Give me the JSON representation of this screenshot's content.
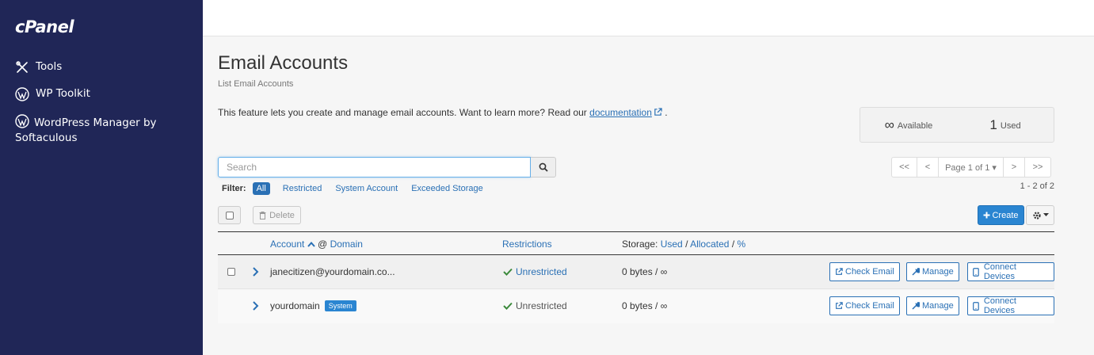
{
  "sidebar": {
    "logo": "cPanel",
    "items": [
      {
        "label": "Tools",
        "icon": "tools-icon"
      },
      {
        "label": "WP Toolkit",
        "icon": "wordpress-icon"
      },
      {
        "label": "WordPress Manager by Softaculous",
        "icon": "wordpress-icon"
      }
    ]
  },
  "page": {
    "title": "Email Accounts",
    "subtitle": "List Email Accounts",
    "intro_text": "This feature lets you create and manage email accounts. Want to learn more? Read our",
    "doc_link": "documentation",
    "intro_end": "."
  },
  "stats": {
    "available_value": "∞",
    "available_label": "Available",
    "used_value": "1",
    "used_label": "Used"
  },
  "search": {
    "placeholder": "Search",
    "value": ""
  },
  "filter": {
    "label": "Filter:",
    "options": [
      "All",
      "Restricted",
      "System Account",
      "Exceeded Storage"
    ],
    "active": "All"
  },
  "pager": {
    "first": "<<",
    "prev": "<",
    "page_label": "Page 1 of 1 ▾",
    "next": ">",
    "last": ">>",
    "range": "1 - 2 of 2"
  },
  "toolbar": {
    "delete_label": "Delete",
    "create_label": "Create"
  },
  "table": {
    "columns": {
      "account": "Account",
      "domain_sep": "@",
      "domain": "Domain",
      "restrictions": "Restrictions",
      "storage_prefix": "Storage:",
      "used": "Used",
      "allocated": "Allocated",
      "percent": "%",
      "sep": "/"
    },
    "rows": [
      {
        "account": "janecitizen@yourdomain.co...",
        "restriction": "Unrestricted",
        "storage": "0 bytes / ∞",
        "badge": ""
      },
      {
        "account": "yourdomain",
        "restriction": "Unrestricted",
        "storage": "0 bytes / ∞",
        "badge": "System"
      }
    ],
    "actions": {
      "check_email": "Check Email",
      "manage": "Manage",
      "connect_devices": "Connect Devices"
    }
  },
  "colors": {
    "sidebar_bg": "#202657",
    "accent": "#2a70b5",
    "create_bg": "#2a85d1",
    "check": "#3c8a3c"
  }
}
